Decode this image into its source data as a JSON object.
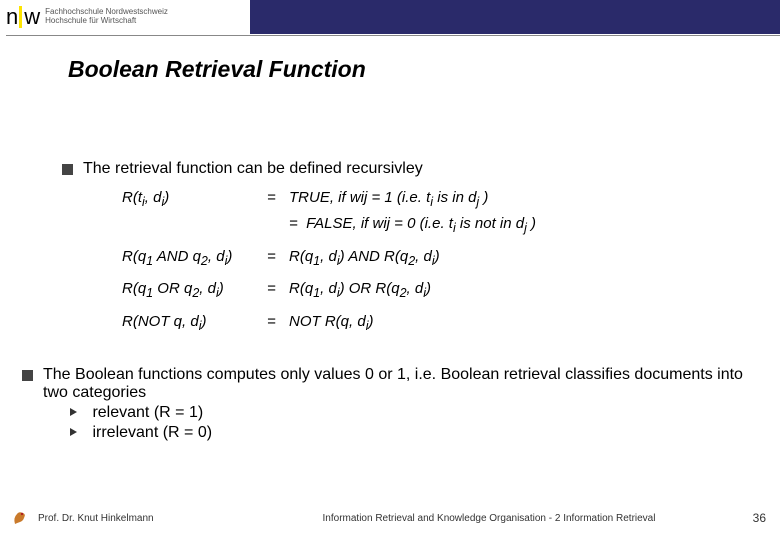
{
  "header": {
    "logo_text_line1": "Fachhochschule Nordwestschweiz",
    "logo_text_line2": "Hochschule für Wirtschaft"
  },
  "title": "Boolean Retrieval Function",
  "bullet_intro": "The retrieval function can be defined recursivley",
  "defs": {
    "r1": {
      "lhs_html": "R(t<sub>i</sub>, d<sub>i</sub>)",
      "rhs_html": "TRUE, if  wij = 1   (i.e. t<sub>i</sub> is in d<sub>j</sub> )<br>=&nbsp;&nbsp;FALSE, if wij = 0   (i.e. t<sub>i</sub> is not in d<sub>j</sub> )"
    },
    "r2": {
      "lhs_html": "R(q<sub>1</sub> AND q<sub>2</sub>, d<sub>i</sub>)",
      "rhs_html": "R(q<sub>1</sub>, d<sub>i</sub>)  AND  R(q<sub>2</sub>, d<sub>i</sub>)"
    },
    "r3": {
      "lhs_html": "R(q<sub>1</sub> OR q<sub>2</sub>, d<sub>i</sub>)",
      "rhs_html": "R(q<sub>1</sub>, d<sub>i</sub>)  OR  R(q<sub>2</sub>, d<sub>i</sub>)"
    },
    "r4": {
      "lhs_html": "R(NOT q, d<sub>i</sub>)",
      "rhs_html": "NOT R(q, d<sub>i</sub>)"
    }
  },
  "bullet_conclusion": "The Boolean functions computes only values 0 or 1, i.e. Boolean retrieval classifies documents into two categories",
  "sub_relevant": "relevant (R = 1)",
  "sub_irrelevant": "irrelevant (R = 0)",
  "footer": {
    "author": "Prof. Dr. Knut Hinkelmann",
    "course": "Information Retrieval and Knowledge Organisation - 2 Information Retrieval",
    "page": "36"
  }
}
